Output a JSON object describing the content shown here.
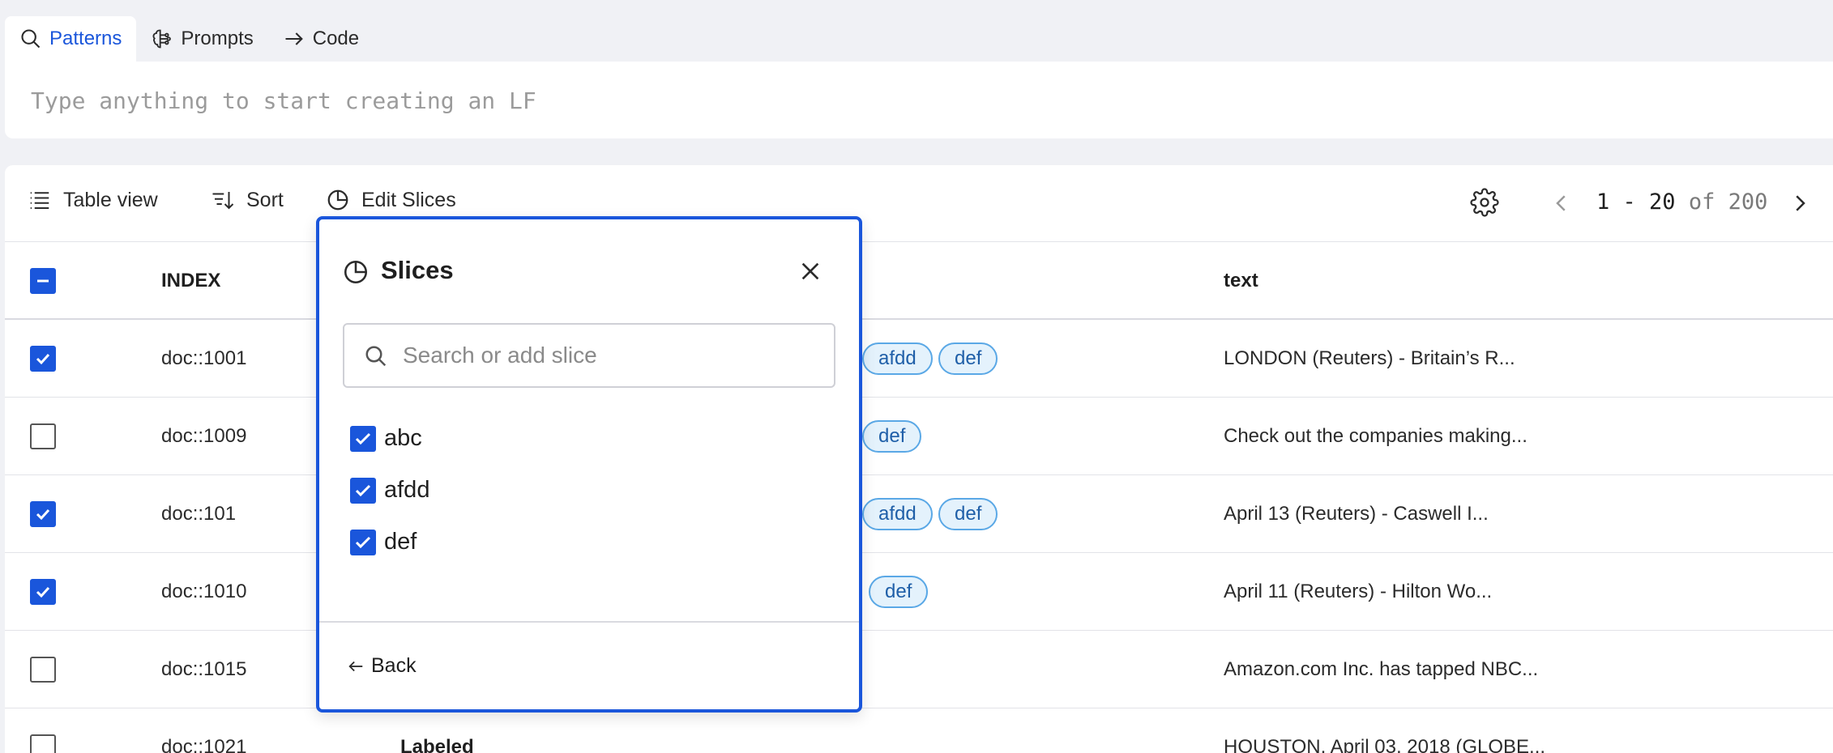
{
  "tabs": [
    {
      "label": "Patterns",
      "icon": "search-icon",
      "active": true
    },
    {
      "label": "Prompts",
      "icon": "brain-icon",
      "active": false
    },
    {
      "label": "Code",
      "icon": "arrow-right-icon",
      "active": false
    }
  ],
  "lf_input": {
    "placeholder": "Type anything to start creating an LF",
    "value": ""
  },
  "toolbar": {
    "table_view": "Table view",
    "sort": "Sort",
    "edit_slices": "Edit Slices"
  },
  "pagination": {
    "range": "1 - 20",
    "of_label": "of",
    "total": "200"
  },
  "table": {
    "headers": {
      "index": "INDEX",
      "text": "text"
    },
    "rows": [
      {
        "index": "doc::1001",
        "checked": true,
        "label": "",
        "slices": [
          "afdd",
          "def"
        ],
        "text": "LONDON (Reuters) - Britain’s R..."
      },
      {
        "index": "doc::1009",
        "checked": false,
        "label": "",
        "slices": [
          "def"
        ],
        "text": "Check out the companies making..."
      },
      {
        "index": "doc::101",
        "checked": true,
        "label": "",
        "slices": [
          "afdd",
          "def"
        ],
        "text": "April 13 (Reuters) - Caswell I..."
      },
      {
        "index": "doc::1010",
        "checked": true,
        "label": "",
        "slices": [
          "def"
        ],
        "text": "April 11 (Reuters) - Hilton Wo..."
      },
      {
        "index": "doc::1015",
        "checked": false,
        "label": "",
        "slices": [],
        "text": "Amazon.com Inc. has tapped NBC..."
      },
      {
        "index": "doc::1021",
        "checked": false,
        "label": "Labeled",
        "slices": [],
        "text": "HOUSTON, April 03, 2018 (GLOBE..."
      }
    ]
  },
  "slices_popover": {
    "title": "Slices",
    "search_placeholder": "Search or add slice",
    "items": [
      {
        "label": "abc",
        "checked": true
      },
      {
        "label": "afdd",
        "checked": true
      },
      {
        "label": "def",
        "checked": true
      }
    ],
    "back_label": "Back"
  },
  "colors": {
    "accent": "#1a56db",
    "chip_border": "#5aa8e6",
    "chip_bg": "#e4f2fc",
    "page_bg": "#f0f1f5"
  }
}
